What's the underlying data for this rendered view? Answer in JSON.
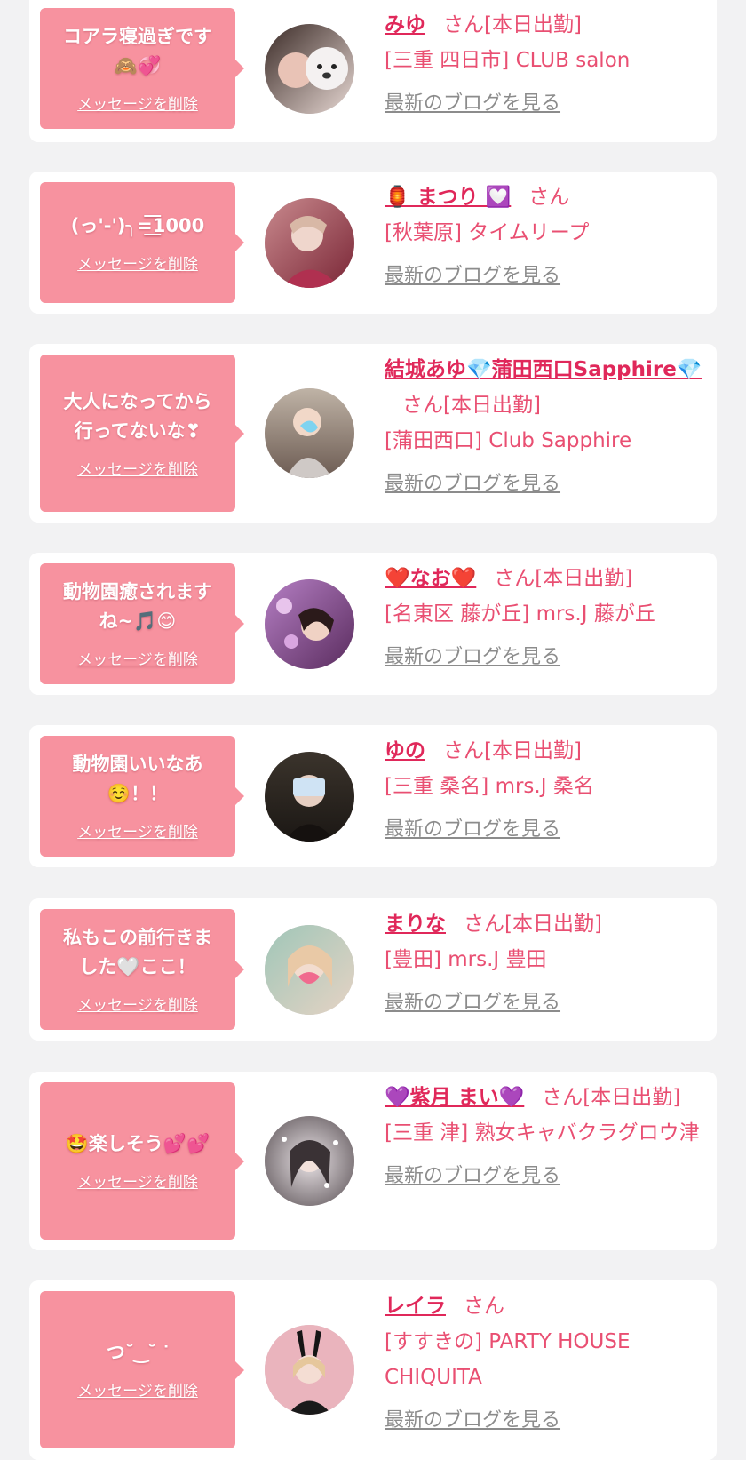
{
  "del_label": "メッセージを削除",
  "blog_label": "最新のブログを見る",
  "cards": [
    {
      "message": "コアラ寝過ぎです\n🙈💞",
      "name": "みゆ",
      "suffix": "さん[本日出勤]",
      "shop": "[三重 四日市] CLUB salon"
    },
    {
      "message": "(っ'-')╮=͟͟͞͞1000",
      "name": "🏮 まつり 💟",
      "suffix": "さん",
      "shop": "[秋葉原] タイムリープ"
    },
    {
      "message": "大人になってから\n行ってないな❣",
      "name": "結城あゆ💎蒲田西口Sapphire💎",
      "suffix": "さん[本日出勤]",
      "shop": "[蒲田西口] Club Sapphire"
    },
    {
      "message": "動物園癒されます\nね~🎵😊",
      "name": "❤️なお❤️",
      "suffix": "さん[本日出勤]",
      "shop": "[名東区 藤が丘] mrs.J 藤が丘"
    },
    {
      "message": "動物園いいなあ\n☺️！！",
      "name": "ゆの",
      "suffix": "さん[本日出勤]",
      "shop": "[三重 桑名] mrs.J 桑名"
    },
    {
      "message": "私もこの前行きま\nした🤍ここ！",
      "name": "まりな",
      "suffix": "さん[本日出勤]",
      "shop": "[豊田] mrs.J 豊田"
    },
    {
      "message": "🤩楽しそう💕💕",
      "name": "💜紫月 まい💜",
      "suffix": "さん[本日出勤]",
      "shop": "[三重 津] 熟女キャバクラグロウ津"
    },
    {
      "message": "つ˘ ͜ ˘ ᐝ",
      "name": "レイラ",
      "suffix": "さん",
      "shop": "[すすきの] PARTY HOUSE CHIQUITA"
    }
  ]
}
